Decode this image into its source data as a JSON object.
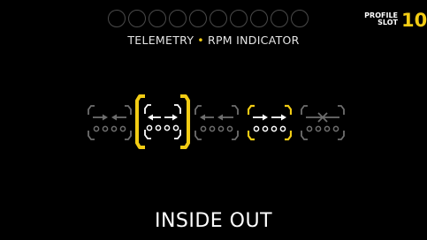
{
  "header": {
    "title_left": "TELEMETRY",
    "title_separator": "•",
    "title_right": "RPM INDICATOR",
    "profile_line1": "PROFILE",
    "profile_line2": "SLOT",
    "slot_number": "10"
  },
  "rpm_leds": {
    "count": 10,
    "lit": 0
  },
  "options": [
    {
      "icon": "arrows-converge-icon",
      "state": "inactive"
    },
    {
      "icon": "arrows-diverge-icon",
      "state": "selected"
    },
    {
      "icon": "arrows-left-icon",
      "state": "inactive"
    },
    {
      "icon": "arrows-right-icon",
      "state": "highlighted"
    },
    {
      "icon": "arrows-off-icon",
      "state": "inactive"
    }
  ],
  "mode_label": "INSIDE OUT",
  "colors": {
    "background": "#000000",
    "accent": "#f2cc14",
    "active": "#ffffff",
    "inactive": "#6e6e6e",
    "led_ring": "#4a4a4a"
  }
}
